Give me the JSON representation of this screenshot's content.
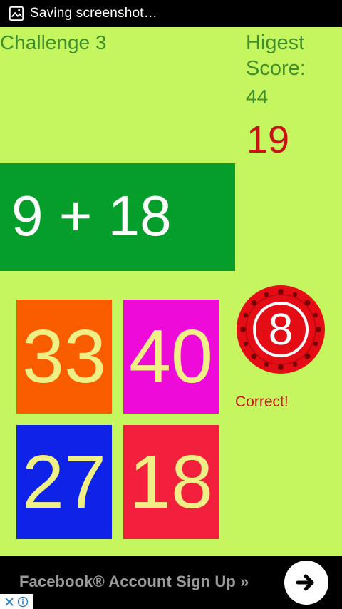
{
  "status_bar": {
    "notification_text": "Saving screenshot…",
    "icon": "screenshot-icon"
  },
  "header": {
    "challenge_title": "Challenge 3",
    "highest_label": "Higest Score:",
    "highest_score": "44",
    "current_score": "19"
  },
  "question": {
    "expression": "9 + 18"
  },
  "answers": [
    {
      "value": "33",
      "color": "#f95d00"
    },
    {
      "value": "40",
      "color": "#ee0ad9"
    },
    {
      "value": "27",
      "color": "#0f23e8"
    },
    {
      "value": "18",
      "color": "#f3203d"
    }
  ],
  "timer": {
    "value": "8",
    "color": "#e50d15"
  },
  "feedback": {
    "text": "Correct!"
  },
  "ad": {
    "text": "Facebook® Account Sign Up »",
    "arrow_icon": "arrow-right-icon",
    "choices_icons": [
      "close-icon",
      "info-icon"
    ]
  },
  "colors": {
    "background": "#c6f65f",
    "title_green": "#3f8f2b",
    "score_red": "#c61414",
    "question_bg": "#069e2a",
    "tile_text": "#f0ef86"
  }
}
